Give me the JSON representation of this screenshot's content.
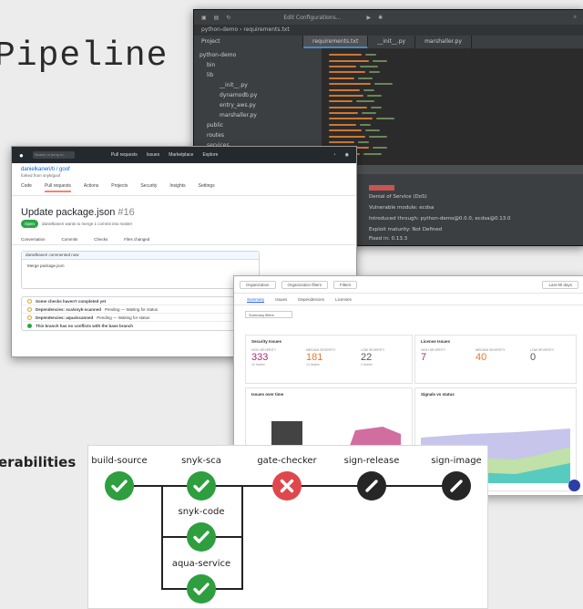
{
  "slide": {
    "title": "Pipeline",
    "side_label": "erabilities"
  },
  "ide": {
    "menu": "Edit  Configurations...",
    "crumbs": "python-demo  ›  requirements.txt",
    "project_label": "Project",
    "tabs": [
      "requirements.txt",
      "__init__.py",
      "marshaller.py"
    ],
    "tree": [
      "python-demo",
      "bin",
      "lib",
      "__init__.py",
      "dynamodb.py",
      "entry_aws.py",
      "marshaller.py",
      "public",
      "routes",
      "services"
    ],
    "panel": {
      "issue_name": "Denial of Service (DoS)",
      "vulnerable_module": "Vulnerable module: ecdsa",
      "introduced": "Introduced through: python-demo@0.0.0, ecdsa@0.13.0",
      "exploit": "Exploit maturity: Not Defined",
      "fixed": "Fixed in: 0.13.3"
    }
  },
  "github": {
    "search": "Search or jump to...",
    "nav_items": [
      "Pull requests",
      "Issues",
      "Marketplace",
      "Explore"
    ],
    "repo": "danielkaneri/ti / goof",
    "repo_sub": "forked from snyk/goof",
    "tabs": [
      "Code",
      "Pull requests",
      "Actions",
      "Projects",
      "Security",
      "Insights",
      "Settings"
    ],
    "pr_title": "Update package.json",
    "pr_number": "#16",
    "pr_state": "Open",
    "pr_meta": "danielkaneri wants to merge 1 commit into master",
    "subtabs": [
      "Conversation",
      "Commits",
      "Checks",
      "Files changed"
    ],
    "comment_head": "danielkaneri commented now",
    "comment_body": "Merge package.json",
    "review_required": "Some checks haven't completed yet",
    "checks": [
      {
        "name": "Dependencies: sca/snyk-scanned",
        "status": "Pending — Waiting for status"
      },
      {
        "name": "Dependencies: aqua/scanned",
        "status": "Pending — Waiting for status"
      }
    ],
    "no_conflicts": "This branch has no conflicts with the base branch"
  },
  "dashboard": {
    "dropdowns": [
      "Organization",
      "Organization filters",
      "Filters",
      "Last 90 days"
    ],
    "tabs": [
      "Summary",
      "Issues",
      "Dependencies",
      "Licenses"
    ],
    "filter": "Summary filters",
    "security_card": {
      "title": "Security Issues",
      "metrics": [
        {
          "label": "High severity",
          "value": "333",
          "sub": "40 fixable",
          "color": "#b3267a"
        },
        {
          "label": "Medium severity",
          "value": "181",
          "sub": "13 fixable",
          "color": "#e8782d"
        },
        {
          "label": "Low severity",
          "value": "22",
          "sub": "0 fixable",
          "color": "#555555"
        }
      ]
    },
    "license_card": {
      "title": "License Issues",
      "metrics": [
        {
          "label": "High severity",
          "value": "7",
          "sub": "",
          "color": "#b3267a"
        },
        {
          "label": "Medium severity",
          "value": "40",
          "sub": "",
          "color": "#e8782d"
        },
        {
          "label": "Low severity",
          "value": "0",
          "sub": "",
          "color": "#555555"
        }
      ]
    },
    "chart_left_title": "Issues over time",
    "chart_right_title": "Signals vs status"
  },
  "pipeline": {
    "stages": [
      {
        "label": "build-source",
        "status": "success"
      },
      {
        "label": "snyk-sca",
        "status": "success"
      },
      {
        "label": "gate-checker",
        "status": "failed"
      },
      {
        "label": "sign-release",
        "status": "skipped"
      },
      {
        "label": "sign-image",
        "status": "skipped"
      }
    ],
    "parallel": [
      {
        "label": "snyk-code",
        "status": "success"
      },
      {
        "label": "aqua-service",
        "status": "success"
      }
    ],
    "colors": {
      "success": "#2e9e3f",
      "failed": "#e0474c",
      "skipped": "#262626"
    }
  }
}
